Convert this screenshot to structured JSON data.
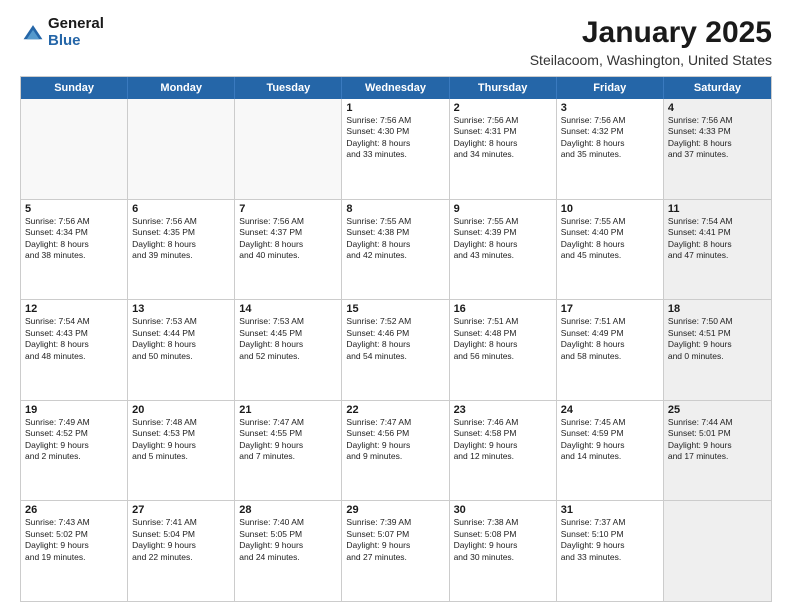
{
  "logo": {
    "general": "General",
    "blue": "Blue"
  },
  "title": {
    "month_year": "January 2025",
    "location": "Steilacoom, Washington, United States"
  },
  "header_days": [
    "Sunday",
    "Monday",
    "Tuesday",
    "Wednesday",
    "Thursday",
    "Friday",
    "Saturday"
  ],
  "rows": [
    [
      {
        "day": "",
        "info": "",
        "shaded": false,
        "empty": true
      },
      {
        "day": "",
        "info": "",
        "shaded": false,
        "empty": true
      },
      {
        "day": "",
        "info": "",
        "shaded": false,
        "empty": true
      },
      {
        "day": "1",
        "info": "Sunrise: 7:56 AM\nSunset: 4:30 PM\nDaylight: 8 hours\nand 33 minutes.",
        "shaded": false,
        "empty": false
      },
      {
        "day": "2",
        "info": "Sunrise: 7:56 AM\nSunset: 4:31 PM\nDaylight: 8 hours\nand 34 minutes.",
        "shaded": false,
        "empty": false
      },
      {
        "day": "3",
        "info": "Sunrise: 7:56 AM\nSunset: 4:32 PM\nDaylight: 8 hours\nand 35 minutes.",
        "shaded": false,
        "empty": false
      },
      {
        "day": "4",
        "info": "Sunrise: 7:56 AM\nSunset: 4:33 PM\nDaylight: 8 hours\nand 37 minutes.",
        "shaded": true,
        "empty": false
      }
    ],
    [
      {
        "day": "5",
        "info": "Sunrise: 7:56 AM\nSunset: 4:34 PM\nDaylight: 8 hours\nand 38 minutes.",
        "shaded": false,
        "empty": false
      },
      {
        "day": "6",
        "info": "Sunrise: 7:56 AM\nSunset: 4:35 PM\nDaylight: 8 hours\nand 39 minutes.",
        "shaded": false,
        "empty": false
      },
      {
        "day": "7",
        "info": "Sunrise: 7:56 AM\nSunset: 4:37 PM\nDaylight: 8 hours\nand 40 minutes.",
        "shaded": false,
        "empty": false
      },
      {
        "day": "8",
        "info": "Sunrise: 7:55 AM\nSunset: 4:38 PM\nDaylight: 8 hours\nand 42 minutes.",
        "shaded": false,
        "empty": false
      },
      {
        "day": "9",
        "info": "Sunrise: 7:55 AM\nSunset: 4:39 PM\nDaylight: 8 hours\nand 43 minutes.",
        "shaded": false,
        "empty": false
      },
      {
        "day": "10",
        "info": "Sunrise: 7:55 AM\nSunset: 4:40 PM\nDaylight: 8 hours\nand 45 minutes.",
        "shaded": false,
        "empty": false
      },
      {
        "day": "11",
        "info": "Sunrise: 7:54 AM\nSunset: 4:41 PM\nDaylight: 8 hours\nand 47 minutes.",
        "shaded": true,
        "empty": false
      }
    ],
    [
      {
        "day": "12",
        "info": "Sunrise: 7:54 AM\nSunset: 4:43 PM\nDaylight: 8 hours\nand 48 minutes.",
        "shaded": false,
        "empty": false
      },
      {
        "day": "13",
        "info": "Sunrise: 7:53 AM\nSunset: 4:44 PM\nDaylight: 8 hours\nand 50 minutes.",
        "shaded": false,
        "empty": false
      },
      {
        "day": "14",
        "info": "Sunrise: 7:53 AM\nSunset: 4:45 PM\nDaylight: 8 hours\nand 52 minutes.",
        "shaded": false,
        "empty": false
      },
      {
        "day": "15",
        "info": "Sunrise: 7:52 AM\nSunset: 4:46 PM\nDaylight: 8 hours\nand 54 minutes.",
        "shaded": false,
        "empty": false
      },
      {
        "day": "16",
        "info": "Sunrise: 7:51 AM\nSunset: 4:48 PM\nDaylight: 8 hours\nand 56 minutes.",
        "shaded": false,
        "empty": false
      },
      {
        "day": "17",
        "info": "Sunrise: 7:51 AM\nSunset: 4:49 PM\nDaylight: 8 hours\nand 58 minutes.",
        "shaded": false,
        "empty": false
      },
      {
        "day": "18",
        "info": "Sunrise: 7:50 AM\nSunset: 4:51 PM\nDaylight: 9 hours\nand 0 minutes.",
        "shaded": true,
        "empty": false
      }
    ],
    [
      {
        "day": "19",
        "info": "Sunrise: 7:49 AM\nSunset: 4:52 PM\nDaylight: 9 hours\nand 2 minutes.",
        "shaded": false,
        "empty": false
      },
      {
        "day": "20",
        "info": "Sunrise: 7:48 AM\nSunset: 4:53 PM\nDaylight: 9 hours\nand 5 minutes.",
        "shaded": false,
        "empty": false
      },
      {
        "day": "21",
        "info": "Sunrise: 7:47 AM\nSunset: 4:55 PM\nDaylight: 9 hours\nand 7 minutes.",
        "shaded": false,
        "empty": false
      },
      {
        "day": "22",
        "info": "Sunrise: 7:47 AM\nSunset: 4:56 PM\nDaylight: 9 hours\nand 9 minutes.",
        "shaded": false,
        "empty": false
      },
      {
        "day": "23",
        "info": "Sunrise: 7:46 AM\nSunset: 4:58 PM\nDaylight: 9 hours\nand 12 minutes.",
        "shaded": false,
        "empty": false
      },
      {
        "day": "24",
        "info": "Sunrise: 7:45 AM\nSunset: 4:59 PM\nDaylight: 9 hours\nand 14 minutes.",
        "shaded": false,
        "empty": false
      },
      {
        "day": "25",
        "info": "Sunrise: 7:44 AM\nSunset: 5:01 PM\nDaylight: 9 hours\nand 17 minutes.",
        "shaded": true,
        "empty": false
      }
    ],
    [
      {
        "day": "26",
        "info": "Sunrise: 7:43 AM\nSunset: 5:02 PM\nDaylight: 9 hours\nand 19 minutes.",
        "shaded": false,
        "empty": false
      },
      {
        "day": "27",
        "info": "Sunrise: 7:41 AM\nSunset: 5:04 PM\nDaylight: 9 hours\nand 22 minutes.",
        "shaded": false,
        "empty": false
      },
      {
        "day": "28",
        "info": "Sunrise: 7:40 AM\nSunset: 5:05 PM\nDaylight: 9 hours\nand 24 minutes.",
        "shaded": false,
        "empty": false
      },
      {
        "day": "29",
        "info": "Sunrise: 7:39 AM\nSunset: 5:07 PM\nDaylight: 9 hours\nand 27 minutes.",
        "shaded": false,
        "empty": false
      },
      {
        "day": "30",
        "info": "Sunrise: 7:38 AM\nSunset: 5:08 PM\nDaylight: 9 hours\nand 30 minutes.",
        "shaded": false,
        "empty": false
      },
      {
        "day": "31",
        "info": "Sunrise: 7:37 AM\nSunset: 5:10 PM\nDaylight: 9 hours\nand 33 minutes.",
        "shaded": false,
        "empty": false
      },
      {
        "day": "",
        "info": "",
        "shaded": true,
        "empty": true
      }
    ]
  ]
}
